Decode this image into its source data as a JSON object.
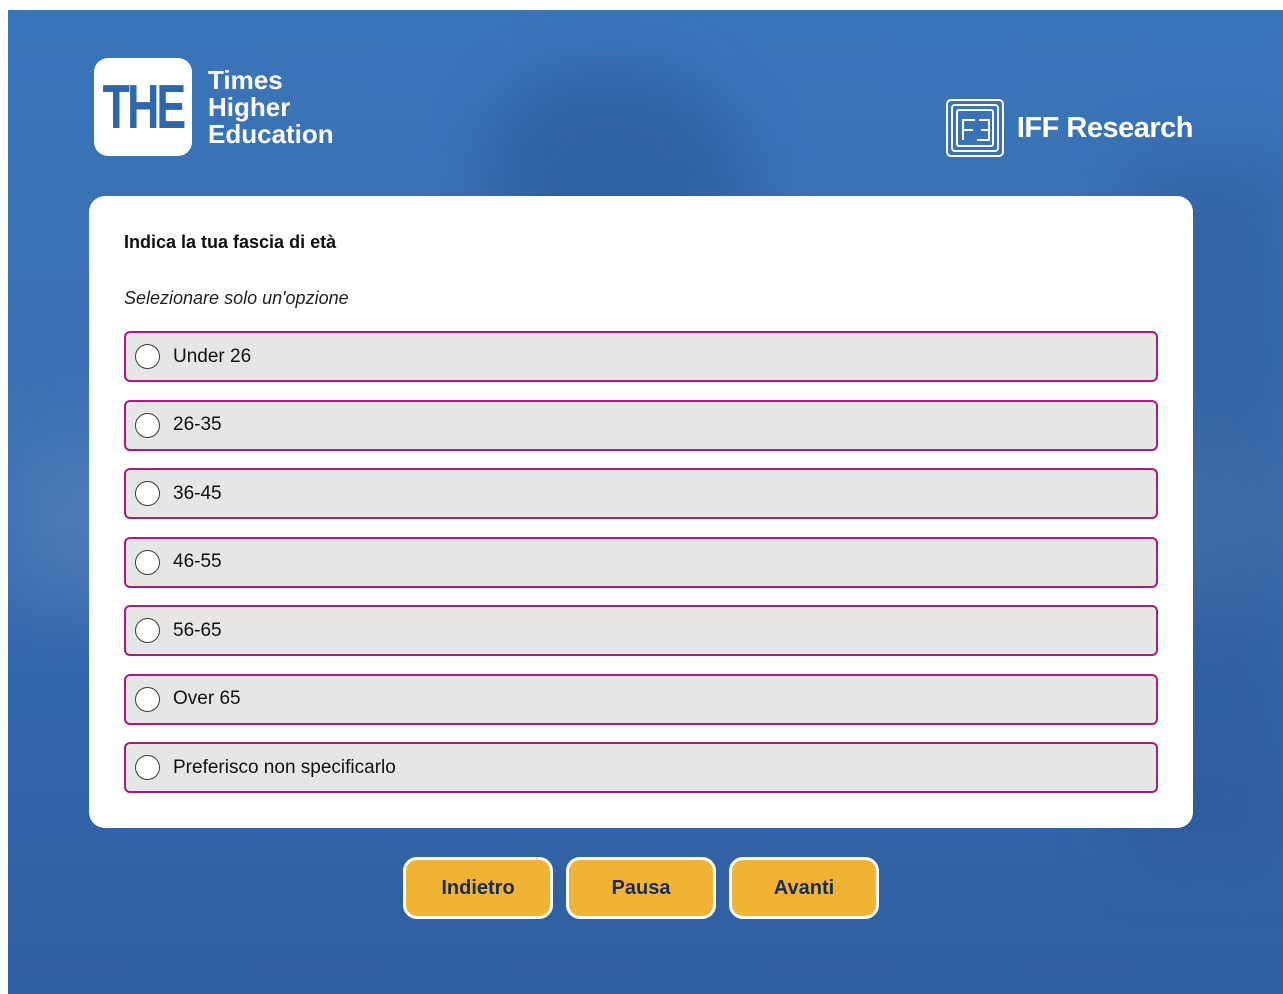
{
  "header": {
    "the_logo": {
      "badge_text": "THE",
      "name_lines": [
        "Times",
        "Higher",
        "Education"
      ]
    },
    "iff_logo": {
      "name": "IFF Research"
    }
  },
  "question": {
    "title": "Indica la tua fascia di età",
    "instruction": "Selezionare solo un'opzione",
    "options": [
      {
        "label": "Under 26",
        "selected": false
      },
      {
        "label": "26-35",
        "selected": false
      },
      {
        "label": "36-45",
        "selected": false
      },
      {
        "label": "46-55",
        "selected": false
      },
      {
        "label": "56-65",
        "selected": false
      },
      {
        "label": "Over 65",
        "selected": false
      },
      {
        "label": "Preferisco non specificarlo",
        "selected": false
      }
    ]
  },
  "nav": {
    "back_label": "Indietro",
    "pause_label": "Pausa",
    "next_label": "Avanti"
  },
  "colors": {
    "background": "#3a74b8",
    "option_border": "#b0177f",
    "option_fill": "#e6e6e6",
    "button_fill": "#f1b334",
    "button_text": "#1b2b4b"
  }
}
